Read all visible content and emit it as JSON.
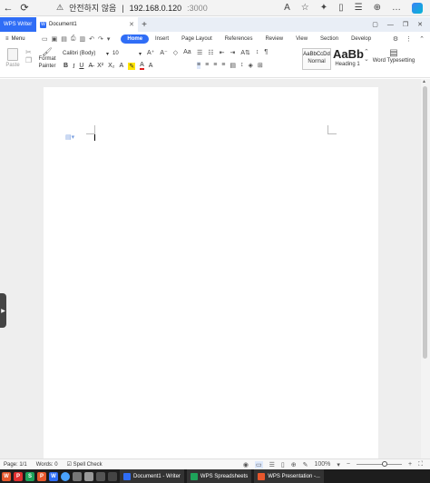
{
  "browser": {
    "security_label": "안전하지 않음",
    "host": "192.168.0.120",
    "port": ":3000",
    "back_glyph": "←",
    "reload_glyph": "⟳",
    "warn_glyph": "⚠"
  },
  "wps_tabs": {
    "app_tab": "WPS Writer",
    "doc_tab": "Document1",
    "add_glyph": "+"
  },
  "menu": {
    "menu_label": "Menu",
    "tabs": [
      "Home",
      "Insert",
      "Page Layout",
      "References",
      "Review",
      "View",
      "Section",
      "Develop"
    ]
  },
  "toolbar": {
    "paste_label": "Paste",
    "format_painter_label": "Format Painter",
    "font_name": "Calibri (Body)",
    "font_size": "10",
    "styles": [
      {
        "preview": "AaBbCcDd",
        "name": "Normal"
      },
      {
        "preview": "AaBb",
        "name": "Heading 1"
      }
    ],
    "typesetting_label": "Word Typesetting"
  },
  "status": {
    "page": "Page: 1/1",
    "words": "Words: 0",
    "spell_check": "Spell Check",
    "zoom": "100%"
  },
  "taskbar": {
    "tasks": [
      "Document1 - Writer",
      "WPS Spreadsheets",
      "WPS Presentation -..."
    ]
  },
  "colors": {
    "accent": "#2f6df6",
    "writer": "#2f6df6",
    "spreadsheets": "#1ea35a",
    "presentation": "#e8572c"
  }
}
